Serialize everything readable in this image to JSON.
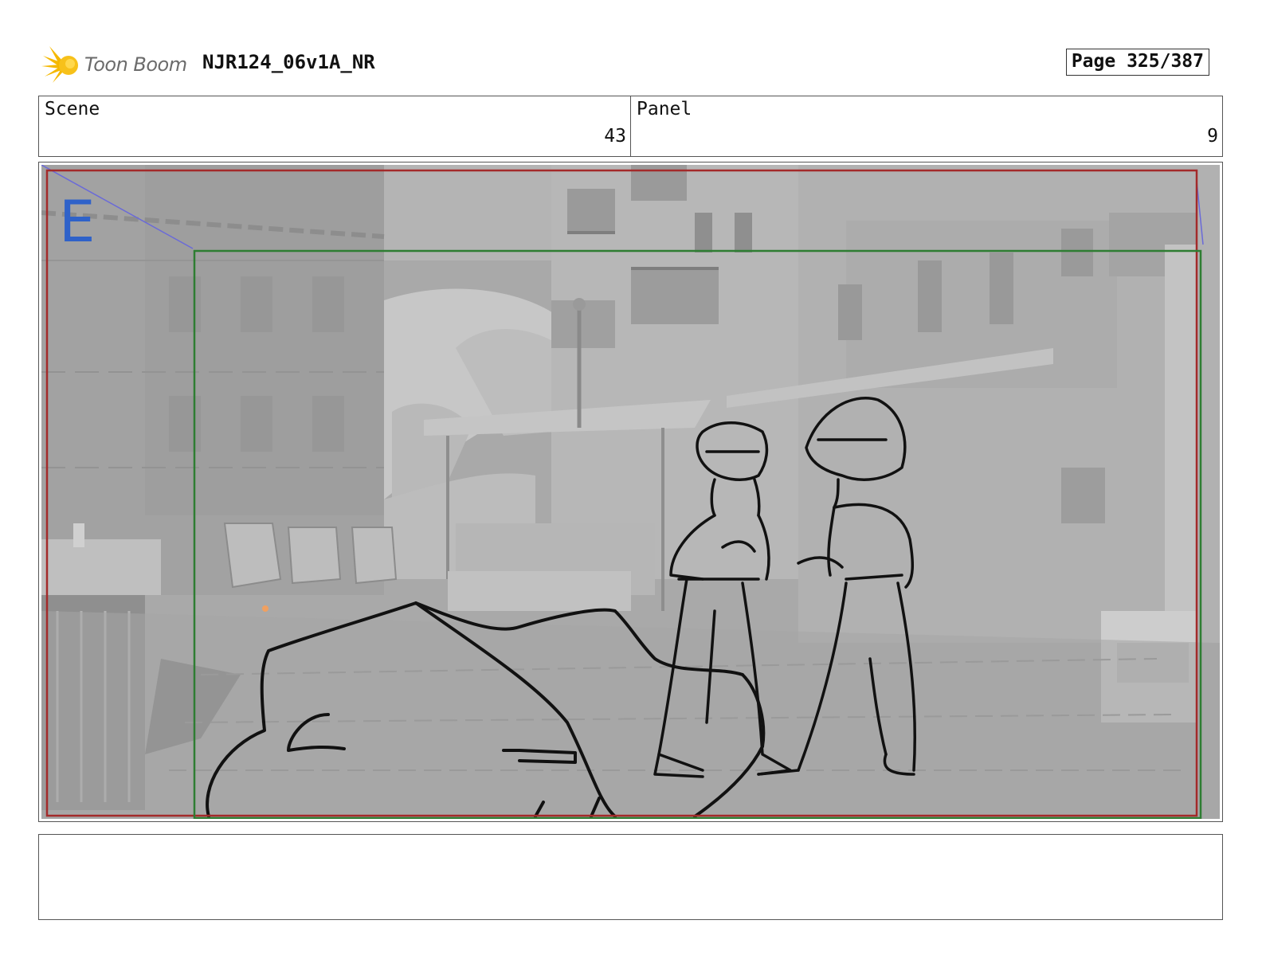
{
  "header": {
    "logo_text": "Toon Boom",
    "project_name": "NJR124_06v1A_NR",
    "page_label": "Page 325/387"
  },
  "info": {
    "scene_label": "Scene",
    "scene_value": "43",
    "panel_label": "Panel",
    "panel_value": "9"
  },
  "frame": {
    "marker_letter": "E",
    "safe_frame_color": "#a32a2a",
    "camera_frame_color": "#2e7d32",
    "marker_color": "#2f62c9"
  },
  "notes": {
    "text": ""
  }
}
